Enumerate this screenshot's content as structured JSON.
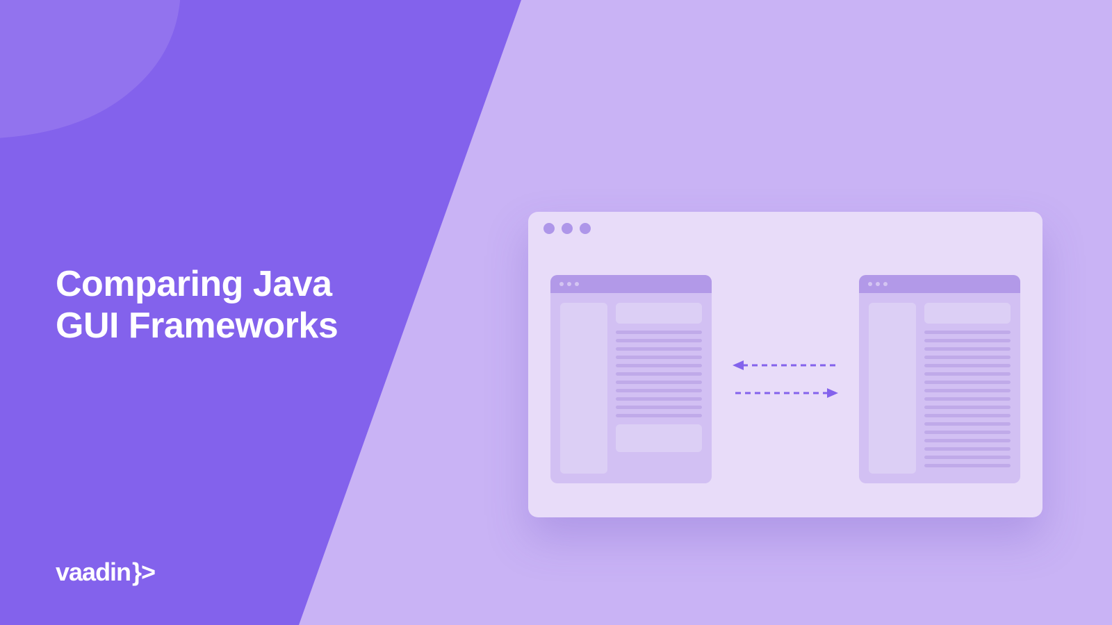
{
  "title_line1": "Comparing Java",
  "title_line2": "GUI Frameworks",
  "logo_text": "vaadin",
  "logo_suffix": "}>",
  "colors": {
    "primary": "#8362ec",
    "light": "#c9b3f5",
    "window_bg": "#e8dcf9",
    "mini_bg": "#d2c0f3",
    "mini_titlebar": "#b299e8",
    "accent_dot": "#ae96e9"
  }
}
